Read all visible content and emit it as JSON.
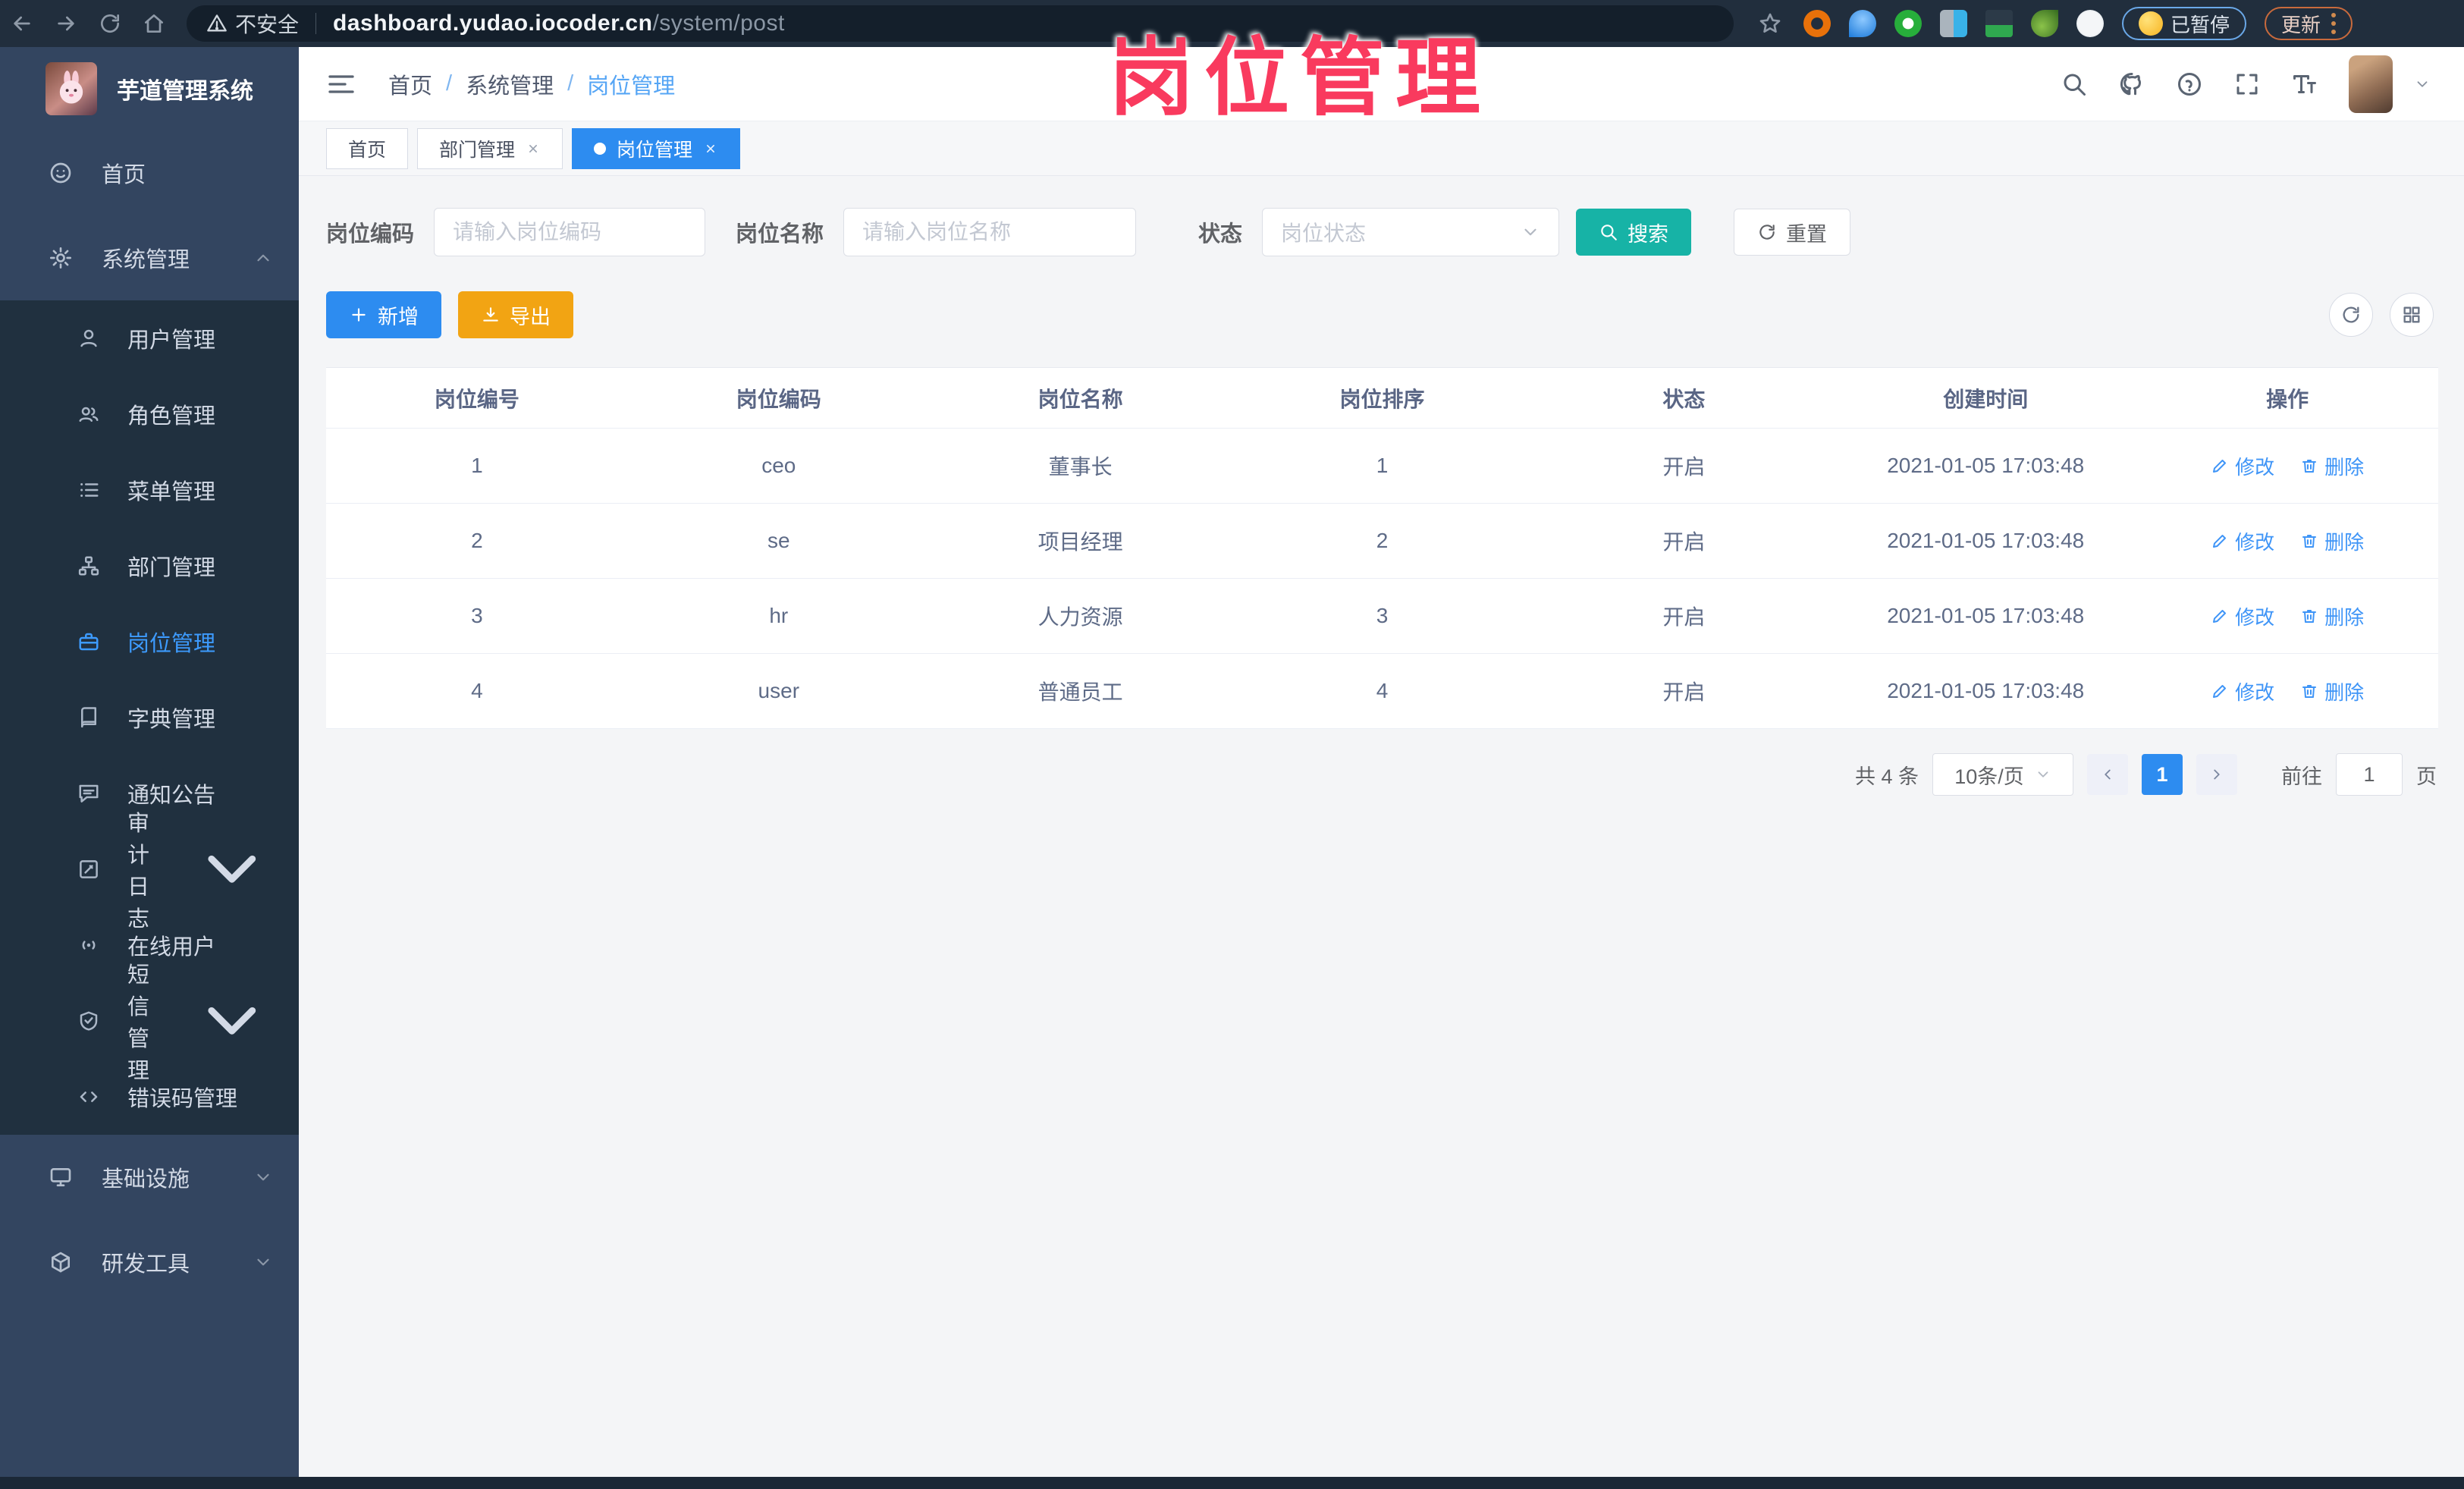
{
  "browser": {
    "security_label": "不安全",
    "url_host": "dashboard.yudao.iocoder.cn",
    "url_path": "/system/post",
    "paused_badge": "已暂停",
    "update_label": "更新"
  },
  "watermark": "岗位管理",
  "sidebar": {
    "title": "芋道管理系统",
    "home": "首页",
    "system": "系统管理",
    "sub": [
      "用户管理",
      "角色管理",
      "菜单管理",
      "部门管理",
      "岗位管理",
      "字典管理",
      "通知公告",
      "审计日志",
      "在线用户",
      "短信管理",
      "错误码管理"
    ],
    "infra": "基础设施",
    "devtools": "研发工具"
  },
  "breadcrumb": {
    "items": [
      "首页",
      "系统管理",
      "岗位管理"
    ],
    "separator": "/"
  },
  "tabs": [
    {
      "label": "首页"
    },
    {
      "label": "部门管理"
    },
    {
      "label": "岗位管理"
    }
  ],
  "filters": {
    "code_label": "岗位编码",
    "code_placeholder": "请输入岗位编码",
    "name_label": "岗位名称",
    "name_placeholder": "请输入岗位名称",
    "status_label": "状态",
    "status_placeholder": "岗位状态",
    "search_label": "搜索",
    "reset_label": "重置"
  },
  "toolbar": {
    "add_label": "新增",
    "export_label": "导出"
  },
  "table": {
    "headers": [
      "岗位编号",
      "岗位编码",
      "岗位名称",
      "岗位排序",
      "状态",
      "创建时间",
      "操作"
    ],
    "rows": [
      {
        "no": "1",
        "code": "ceo",
        "name": "董事长",
        "sort": "1",
        "status": "开启",
        "created": "2021-01-05 17:03:48"
      },
      {
        "no": "2",
        "code": "se",
        "name": "项目经理",
        "sort": "2",
        "status": "开启",
        "created": "2021-01-05 17:03:48"
      },
      {
        "no": "3",
        "code": "hr",
        "name": "人力资源",
        "sort": "3",
        "status": "开启",
        "created": "2021-01-05 17:03:48"
      },
      {
        "no": "4",
        "code": "user",
        "name": "普通员工",
        "sort": "4",
        "status": "开启",
        "created": "2021-01-05 17:03:48"
      }
    ],
    "edit_label": "修改",
    "delete_label": "删除"
  },
  "pagination": {
    "total": "共 4 条",
    "page_size": "10条/页",
    "page": "1",
    "goto_label": "前往",
    "goto_value": "1",
    "unit_label": "页"
  },
  "colors": {
    "primary": "#2d8cf0",
    "active_link": "#3d9bff",
    "teal": "#17b3a6",
    "warning": "#f2a413",
    "watermark_pink": "#f93a5e"
  }
}
